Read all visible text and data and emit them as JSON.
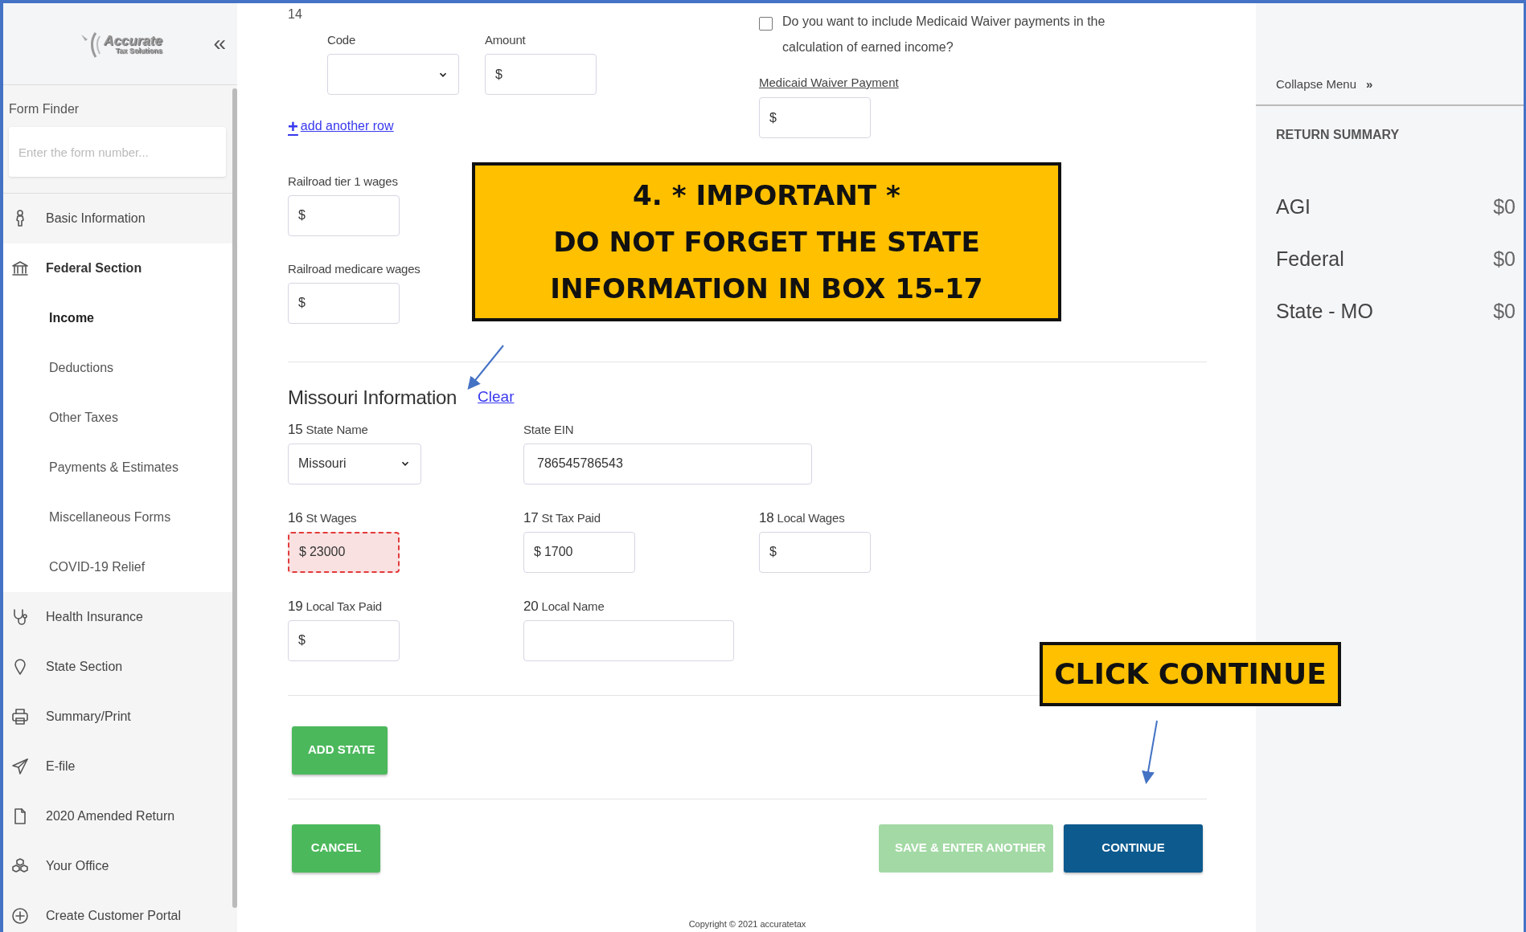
{
  "sidebar": {
    "logo": {
      "name": "Accurate",
      "tagline": "Tax Solutions"
    },
    "collapse_icon": "«",
    "form_finder": {
      "label": "Form Finder",
      "placeholder": "Enter the form number..."
    },
    "items": [
      {
        "label": "Basic Information",
        "expanded": false
      },
      {
        "label": "Federal Section",
        "expanded": true,
        "children": [
          {
            "label": "Income",
            "selected": true
          },
          {
            "label": "Deductions",
            "selected": false
          },
          {
            "label": "Other Taxes",
            "selected": false
          },
          {
            "label": "Payments & Estimates",
            "selected": false
          },
          {
            "label": "Miscellaneous Forms",
            "selected": false
          },
          {
            "label": "COVID-19 Relief",
            "selected": false
          }
        ]
      },
      {
        "label": "Health Insurance",
        "expanded": false
      },
      {
        "label": "State Section",
        "expanded": false
      },
      {
        "label": "Summary/Print",
        "expanded": false
      },
      {
        "label": "E-file",
        "expanded": false
      },
      {
        "label": "2020 Amended Return",
        "expanded": false
      },
      {
        "label": "Your Office",
        "expanded": false
      },
      {
        "label": "Create Customer Portal",
        "expanded": false
      }
    ]
  },
  "box14": {
    "number": "14",
    "code": {
      "label": "Code"
    },
    "amount": {
      "label": "Amount",
      "prefix": "$"
    }
  },
  "medicaid": {
    "checked": false,
    "question": "Do you want to include Medicaid Waiver payments in the calculation of earned income?",
    "payment_label": "Medicaid Waiver Payment",
    "prefix": "$"
  },
  "add_row": {
    "icon": "+",
    "label": "add another row"
  },
  "railroad": [
    {
      "label": "Railroad tier 1 wages",
      "prefix": "$"
    },
    {
      "label": "Railroad medicare wages",
      "prefix": "$"
    }
  ],
  "state": {
    "title": "Missouri Information",
    "clear": "Clear",
    "rows": [
      [
        {
          "number": "15",
          "label": "State Name",
          "kind": "select",
          "value": "Missouri",
          "error": false
        },
        {
          "label": "State EIN",
          "kind": "text",
          "value": "786545786543",
          "error": false
        }
      ],
      [
        {
          "number": "16",
          "label": "St Wages",
          "kind": "money",
          "prefix": "$",
          "value": "23000",
          "error": true
        },
        {
          "number": "17",
          "label": "St Tax Paid",
          "kind": "money",
          "prefix": "$",
          "value": "1700",
          "error": false
        },
        {
          "number": "18",
          "label": "Local Wages",
          "kind": "money",
          "prefix": "$",
          "error": false
        }
      ],
      [
        {
          "number": "19",
          "label": "Local Tax Paid",
          "kind": "money",
          "prefix": "$",
          "error": false
        },
        {
          "number": "20",
          "label": "Local Name",
          "kind": "text",
          "error": false
        }
      ]
    ]
  },
  "buttons": {
    "add_state": {
      "label": "ADD STATE",
      "disabled": false
    },
    "cancel": {
      "label": "CANCEL",
      "disabled": false
    },
    "save_another": {
      "label": "SAVE & ENTER ANOTHER",
      "disabled": true
    },
    "continue": {
      "label": "CONTINUE",
      "disabled": false
    }
  },
  "copyright": "Copyright © 2021 accuratetax",
  "summary": {
    "collapse": {
      "label": "Collapse Menu",
      "icon": "»"
    },
    "title": "RETURN SUMMARY",
    "rows": [
      {
        "label": "AGI",
        "value": "$0"
      },
      {
        "label": "Federal",
        "value": "$0"
      },
      {
        "label": "State - MO",
        "value": "$0"
      }
    ]
  },
  "annotations": [
    {
      "lines": [
        "4. * IMPORTANT *",
        "DO NOT FORGET THE STATE",
        "INFORMATION IN BOX 15-17"
      ]
    },
    {
      "lines": [
        "CLICK CONTINUE"
      ]
    }
  ]
}
